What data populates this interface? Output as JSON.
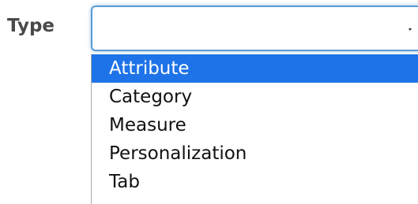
{
  "field": {
    "label": "Type",
    "value": "",
    "caret_icon": "caret-down-icon"
  },
  "dropdown": {
    "highlighted_index": 0,
    "highlight_color": "#1e73e8",
    "options": [
      {
        "label": "Attribute"
      },
      {
        "label": "Category"
      },
      {
        "label": "Measure"
      },
      {
        "label": "Personalization"
      },
      {
        "label": "Tab"
      }
    ]
  }
}
